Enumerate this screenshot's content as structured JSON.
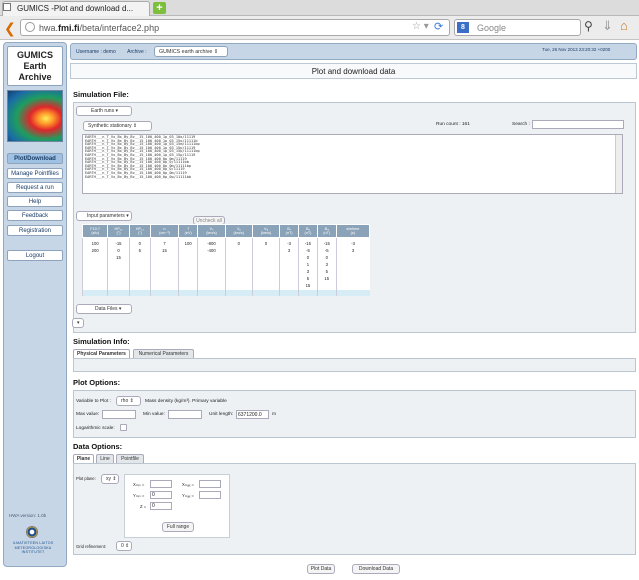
{
  "browser": {
    "tab_title": "GUMICS -Plot and download d...",
    "new_tab": "+",
    "url_domain_pre": "hwa.",
    "url_domain_bold": "fmi.fi",
    "url_path": "/beta/interface2.php",
    "search_placeholder": "Google",
    "search_engine": "8"
  },
  "sidebar": {
    "title_line1": "GUMICS",
    "title_line2": "Earth",
    "title_line3": "Archive",
    "items": [
      {
        "label": "Plot/Download",
        "active": true
      },
      {
        "label": "Manage Pointfiles",
        "active": false
      },
      {
        "label": "Request a run",
        "active": false
      },
      {
        "label": "Help",
        "active": false
      },
      {
        "label": "Feedback",
        "active": false
      },
      {
        "label": "Registration",
        "active": false
      }
    ],
    "logout": "Logout",
    "version": "HWA version: 1.0b",
    "institute_lines": [
      "ILMATIETEEN LAITOS",
      "METEOROLOGISKA",
      "INSTITUTET"
    ]
  },
  "header": {
    "username_label": "Username : demo",
    "archive_label": "Archive :",
    "archive_value": "GUMICS earth archive",
    "datetime": "Tue, 26 Nov 2013 23:20:32 +0200",
    "page_title": "Plot and download data"
  },
  "simulation_file": {
    "heading": "Simulation File:",
    "runs_select": "Earth runs",
    "type_select": "Synthetic stationary",
    "run_count": "Run count : 161",
    "search_label": "Search :",
    "search_value": "",
    "files": [
      "EARTH___n_T_Vx_Bx_By_Bz__15_100_400_1p_03_10o/11119",
      "EARTH___n_T_Vx_Bx_By_Bz__15_100_400_1p_03_15o/11111b",
      "EARTH___n_T_Vx_Bx_By_Bz__15_100_400_1p_03_15m/11111bp",
      "EARTH___n_T_Vx_Bx_By_Bz__15_100_400_1p_03_15p/11119",
      "EARTH___n_T_Vx_Bx_By_Bz__15_100_400_1p_03_15p/11111bp",
      "EARTH___n_T_Vx_Bx_By_Bz__15_100_400_1p_03_15p/11119",
      "EARTH___n_T_Vx_Bx_By_Bz__15_100_400_0p_0m/11119",
      "EARTH___n_T_Vx_Bx_By_Bz__15_100_400_0p_0/11111bb",
      "EARTH___n_T_Vx_Bx_By_Bz__15_100_400_0p_0m/11111bp",
      "EARTH___n_T_Vx_Bx_By_Bz__15_100_400_0p_0/11119",
      "EARTH___n_T_Vx_Bx_By_Bz__15_100_400_0p_0m/11119",
      "EARTH___n_T_Vx_Bx_By_Bz__15_100_400_0p_0p/11111bb"
    ],
    "input_params_select": "Input parameters",
    "uncheck_all": "Uncheck all",
    "table_headers": [
      [
        "F10.7",
        "(sfu)"
      ],
      [
        "HP₁₂",
        "(°)"
      ],
      [
        "HP₁₂",
        "(°)"
      ],
      [
        "n",
        "(cm⁻³)"
      ],
      [
        "T",
        "(eV)"
      ],
      [
        "Vₓ",
        "(km/s)"
      ],
      [
        "Vᵧ",
        "(km/s)"
      ],
      [
        "Vᵩ",
        "(km/s)"
      ],
      [
        "Bₓ",
        "(nT)"
      ],
      [
        "Bᵧ",
        "(nT)"
      ],
      [
        "Bᵩ",
        "(nT)"
      ],
      [
        "simtime",
        "(s)"
      ]
    ],
    "table_columns": [
      [
        "100",
        "200"
      ],
      [
        "-15",
        "0",
        "15"
      ],
      [
        "0",
        "5"
      ],
      [
        "7",
        "15"
      ],
      [
        "100"
      ],
      [
        "-800",
        "-400"
      ],
      [
        "0"
      ],
      [
        "0"
      ],
      [
        "-3",
        "3"
      ],
      [
        "-15",
        "-5",
        "0",
        "1",
        "3",
        "5",
        "15"
      ],
      [
        "-15",
        "-5",
        "0",
        "3",
        "5",
        "15"
      ],
      [
        "-3",
        "3"
      ]
    ],
    "data_files_select": "Data Files",
    "small_select": ""
  },
  "simulation_info": {
    "heading": "Simulation Info:",
    "tabs": [
      "Physical Parameters",
      "Numerical Parameters"
    ]
  },
  "plot_options": {
    "heading": "Plot Options:",
    "variable_label": "Variable to Plot :",
    "variable_value": "rho",
    "variable_desc": "Mass density (kg/m³). Primary variable",
    "max_label": "Max value:",
    "min_label": "Min value:",
    "unit_length_label": "Unit length:",
    "unit_length_value": "6371200.0",
    "unit_length_unit": "m",
    "log_label": "Logarithmic scale:"
  },
  "data_options": {
    "heading": "Data Options:",
    "tabs": [
      "Plane",
      "Line",
      "Pointfile"
    ],
    "plot_plane_label": "Plot plane:",
    "plot_plane_value": "xy",
    "xmin_label": "Xₘᵢₙ =",
    "xmax_label": "Xₘₐₓ =",
    "ymin_label": "Yₘᵢₙ =",
    "ymin_value": "0",
    "ymax_label": "Yₘₐₓ =",
    "z_label": "Z =",
    "z_value": "0",
    "full_range": "Full range",
    "grid_label": "Grid refinement:",
    "grid_value": "0"
  },
  "actions": {
    "plot": "Plot Data",
    "download": "Download Data"
  }
}
